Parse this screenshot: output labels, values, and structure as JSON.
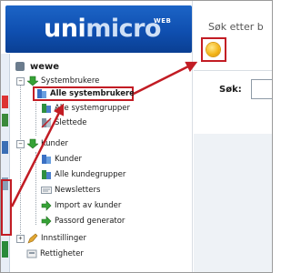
{
  "header": {
    "logo_main": "uni",
    "logo_accent": "micro",
    "logo_suffix": "WEB"
  },
  "search": {
    "title": "Søk etter b",
    "label": "Søk:",
    "value": ""
  },
  "tree": {
    "user": "wewe",
    "systembrukere": {
      "label": "Systembrukere",
      "children": [
        "Alle systembrukere",
        "Alle systemgrupper",
        "Slettede"
      ]
    },
    "kunder": {
      "label": "Kunder",
      "children": [
        "Kunder",
        "Alle kundegrupper",
        "Newsletters",
        "Import av kunder",
        "Passord generator"
      ]
    },
    "innstillinger": "Innstillinger",
    "rettigheter": "Rettigheter"
  },
  "colors": {
    "highlight": "#c21c24",
    "brand": "#0f4fb0"
  }
}
